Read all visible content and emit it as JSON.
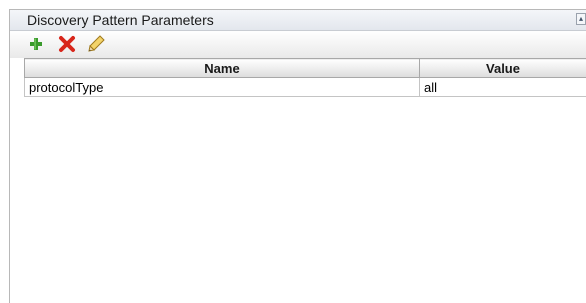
{
  "panel": {
    "title": "Discovery Pattern Parameters",
    "collapse_icon": "double-chevron-up-icon"
  },
  "toolbar": {
    "add_icon": "plus-icon",
    "delete_icon": "red-x-icon",
    "edit_icon": "pencil-icon",
    "colors": {
      "add": "#3a9a2c",
      "delete": "#d8261b",
      "edit": "#e0b43a"
    }
  },
  "table": {
    "columns": [
      "Name",
      "Value"
    ],
    "rows": [
      {
        "name": "protocolType",
        "value": "all"
      }
    ]
  }
}
